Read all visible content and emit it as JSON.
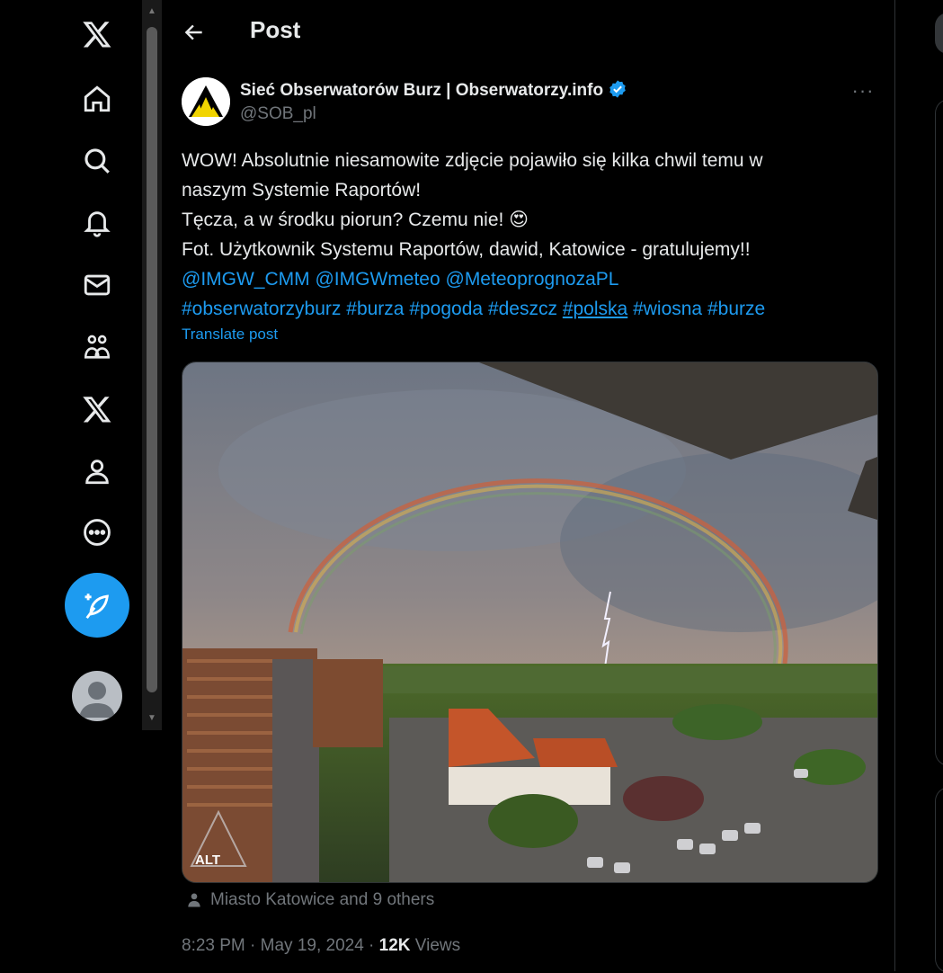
{
  "nav": {
    "items": [
      {
        "name": "x-logo-icon"
      },
      {
        "name": "home-icon"
      },
      {
        "name": "search-icon"
      },
      {
        "name": "notifications-bell-icon"
      },
      {
        "name": "messages-envelope-icon"
      },
      {
        "name": "communities-icon"
      },
      {
        "name": "premium-x-icon"
      },
      {
        "name": "profile-icon"
      },
      {
        "name": "more-circle-icon"
      }
    ],
    "compose_icon": "compose-feather-icon"
  },
  "header": {
    "title": "Post"
  },
  "post": {
    "author_name": "Sieć Obserwatorów Burz | Obserwatorzy.info",
    "handle": "@SOB_pl",
    "more": "···",
    "text_lines": [
      "WOW! Absolutnie niesamowite zdjęcie pojawiło się kilka chwil temu w",
      "naszym Systemie Raportów!",
      "Tęcza, a w środku piorun? Czemu nie! 😍",
      "Fot. Użytkownik Systemu Raportów, dawid, Katowice - gratulujemy!!"
    ],
    "mentions": [
      "@IMGW_CMM",
      "@IMGWmeteo",
      "@MeteoprognozaPL"
    ],
    "hashtags": [
      "#obserwatorzyburz",
      "#burza",
      "#pogoda",
      "#deszcz",
      "#polska",
      "#wiosna",
      "#burze"
    ],
    "translate": "Translate post",
    "alt_badge": "ALT",
    "tagged": "Miasto Katowice and 9 others",
    "time": "8:23 PM · May 19, 2024 · ",
    "views_count": "12K",
    "views_label": " Views"
  },
  "colors": {
    "accent": "#1d9bf0",
    "muted": "#71767b",
    "text": "#e7e9ea",
    "bg": "#000000"
  }
}
